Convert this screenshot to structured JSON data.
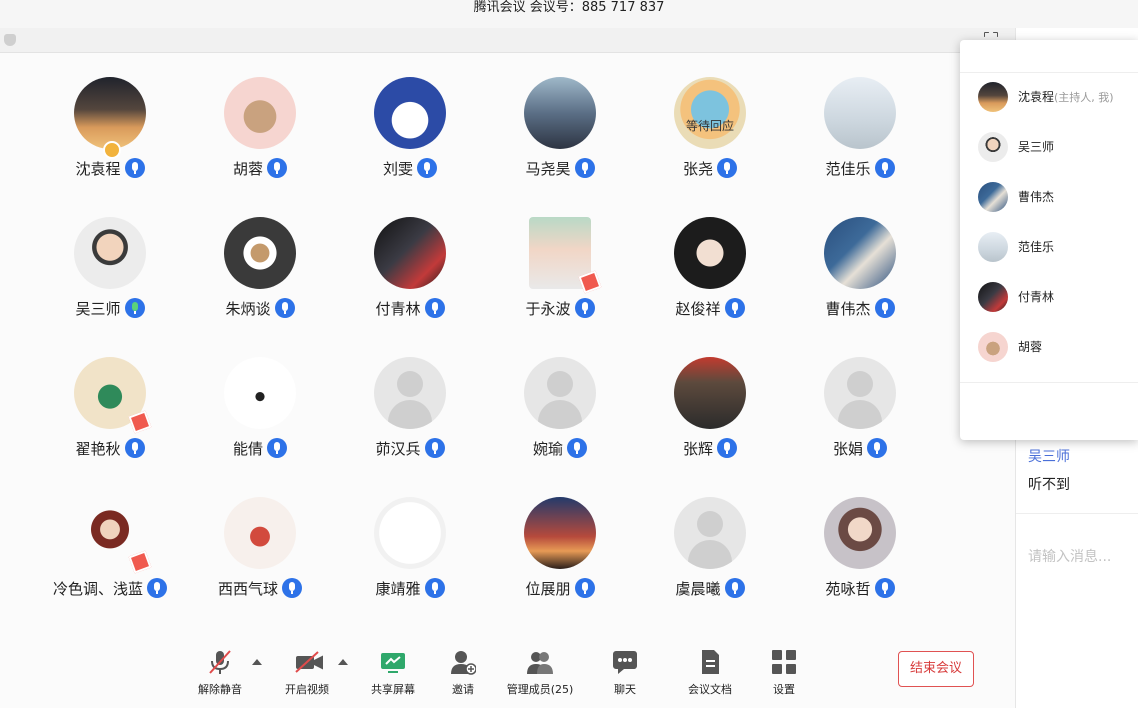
{
  "window": {
    "title": "腾讯会议 会议号：885 717 837"
  },
  "participants": [
    {
      "name": "沈袁程",
      "avatar": "photo-sunset",
      "mic": "blue",
      "host": true
    },
    {
      "name": "胡蓉",
      "avatar": "cartoon-mouse",
      "mic": "blue"
    },
    {
      "name": "刘雯",
      "avatar": "cartoon-rabbit",
      "mic": "blue"
    },
    {
      "name": "马尧昊",
      "avatar": "photo-street",
      "mic": "blue"
    },
    {
      "name": "张尧",
      "avatar": "cartoon-squirtle",
      "mic": "blue",
      "overlay": "等待回应"
    },
    {
      "name": "范佳乐",
      "avatar": "photo-child",
      "mic": "blue"
    },
    {
      "name": "吴三师",
      "avatar": "photo-kid",
      "mic": "green"
    },
    {
      "name": "朱炳谈",
      "avatar": "photo-coffee",
      "mic": "blue"
    },
    {
      "name": "付青林",
      "avatar": "anime-dark",
      "mic": "blue"
    },
    {
      "name": "于永波",
      "avatar": "photo-selfie",
      "mic": "blue",
      "flag": true,
      "square": true
    },
    {
      "name": "赵俊祥",
      "avatar": "anime-mask",
      "mic": "blue"
    },
    {
      "name": "曹伟杰",
      "avatar": "photo-drink",
      "mic": "blue"
    },
    {
      "name": "翟艳秋",
      "avatar": "cartoon-couple",
      "mic": "blue",
      "flag": true
    },
    {
      "name": "能倩",
      "avatar": "sketch-couple",
      "mic": "blue"
    },
    {
      "name": "茆汉兵",
      "avatar": "default",
      "mic": "blue"
    },
    {
      "name": "婉瑜",
      "avatar": "default",
      "mic": "blue"
    },
    {
      "name": "张辉",
      "avatar": "photo-guy",
      "mic": "blue"
    },
    {
      "name": "张娟",
      "avatar": "default",
      "mic": "blue"
    },
    {
      "name": "冷色调、浅蓝",
      "avatar": "anime-boy",
      "mic": "blue",
      "flag": true
    },
    {
      "name": "西西气球",
      "avatar": "anime-girl",
      "mic": "blue"
    },
    {
      "name": "康靖雅",
      "avatar": "cartoon-bear",
      "mic": "blue"
    },
    {
      "name": "位展朋",
      "avatar": "photo-night",
      "mic": "blue"
    },
    {
      "name": "虞晨曦",
      "avatar": "default",
      "mic": "blue"
    },
    {
      "name": "苑咏哲",
      "avatar": "anime-scarf",
      "mic": "blue"
    }
  ],
  "toolbar": {
    "unmute": "解除静音",
    "start_video": "开启视频",
    "share_screen": "共享屏幕",
    "invite": "邀请",
    "manage_members": "管理成员(25)",
    "chat": "聊天",
    "docs": "会议文档",
    "settings": "设置",
    "end_meeting": "结束会议"
  },
  "members_panel": [
    {
      "name": "沈袁程",
      "role": "(主持人, 我)",
      "avatar": "photo-sunset"
    },
    {
      "name": "吴三师",
      "role": "",
      "avatar": "photo-kid"
    },
    {
      "name": "曹伟杰",
      "role": "",
      "avatar": "photo-drink"
    },
    {
      "name": "范佳乐",
      "role": "",
      "avatar": "photo-child"
    },
    {
      "name": "付青林",
      "role": "",
      "avatar": "anime-dark"
    },
    {
      "name": "胡蓉",
      "role": "",
      "avatar": "cartoon-mouse"
    }
  ],
  "chat": {
    "sender": "吴三师",
    "message": "听不到",
    "input_placeholder": "请输入消息..."
  },
  "colors": {
    "accent_blue": "#2d72e8",
    "end_red": "#d73b3b",
    "share_green": "#2fa86b"
  }
}
